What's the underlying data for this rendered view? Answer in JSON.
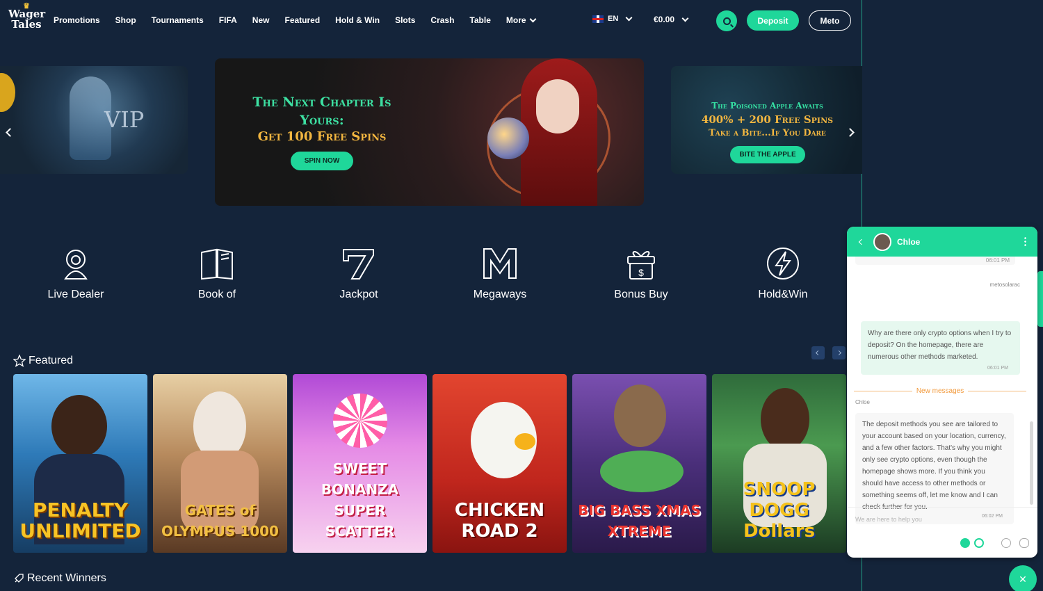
{
  "header": {
    "logo_line1": "Wager",
    "logo_line2": "Tales",
    "nav": [
      "Promotions",
      "Shop",
      "Tournaments",
      "FIFA",
      "New",
      "Featured",
      "Hold & Win",
      "Slots",
      "Crash",
      "Table"
    ],
    "more_label": "More",
    "language": "EN",
    "balance": "€0.00",
    "deposit_label": "Deposit",
    "user_label": "Meto"
  },
  "banners": {
    "left_text": "VIP",
    "main_title": "The Next Chapter Is Yours:",
    "main_sub": "Get 100 Free Spins",
    "main_cta": "SPIN NOW",
    "right_line1": "The Poisoned Apple Awaits",
    "right_line2": "400% + 200 Free Spins",
    "right_line3": "Take a Bite...If You Dare",
    "right_cta": "BITE THE APPLE"
  },
  "categories": [
    "Live Dealer",
    "Book of",
    "Jackpot",
    "Megaways",
    "Bonus Buy",
    "Hold&Win"
  ],
  "featured": {
    "title": "Featured",
    "games": [
      {
        "title": "PENALTY UNLIMITED",
        "bg": "#2e7ab8",
        "accent": "#f7c325"
      },
      {
        "title": "GATES of OLYMPUS 1000",
        "bg": "#8a6a4a",
        "accent": "#f2c043"
      },
      {
        "title": "SWEET BONANZA SUPER SCATTER",
        "bg": "#c86ad8",
        "accent": "#e53a59"
      },
      {
        "title": "CHICKEN ROAD 2",
        "bg": "#d63a2a",
        "accent": "#ffffff"
      },
      {
        "title": "BIG BASS XMAS XTREME",
        "bg": "#5b3c8a",
        "accent": "#e8342f"
      },
      {
        "title": "SNOOP DOGG Dollars",
        "bg": "#3a8a4a",
        "accent": "#f5c21b"
      }
    ]
  },
  "recent_winners": "Recent Winners",
  "chat": {
    "agent_name": "Chloe",
    "time_prev": "06:01 PM",
    "user_handle": "metosolarac",
    "user_message": "Why are there only crypto options when I try to deposit? On the homepage, there are numerous other methods marketed.",
    "user_time": "06:01 PM",
    "new_messages": "New messages",
    "agent_label": "Chloe",
    "agent_message": "The deposit methods you see are tailored to your account based on your location, currency, and a few other factors. That's why you might only see crypto options, even though the homepage shows more. If you think you should have access to other methods or something seems off, let me know and I can check further for you.",
    "agent_time": "06:02 PM",
    "input_placeholder": "We are here to help you"
  },
  "colors": {
    "background": "#14243a",
    "accent": "#1fd79a",
    "gold": "#f2b640"
  }
}
